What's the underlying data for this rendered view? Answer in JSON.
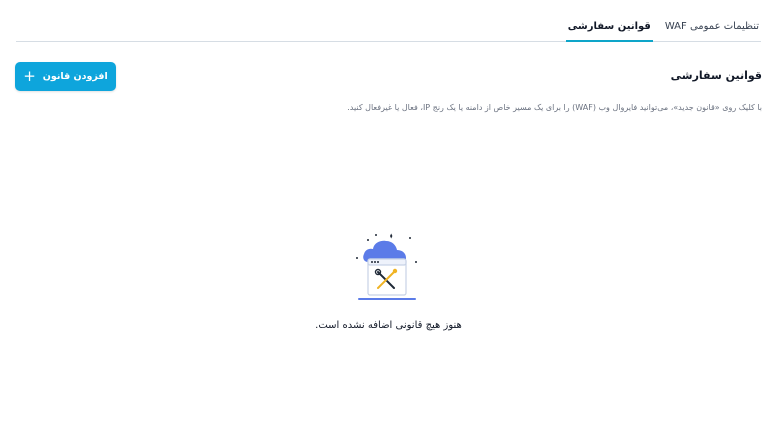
{
  "tabs": [
    {
      "label": "تنظیمات عمومی WAF",
      "active": false
    },
    {
      "label": "قوانین سفارشی",
      "active": true
    }
  ],
  "section": {
    "title": "قوانین سفارشی",
    "add_button_label": "افزودن قانون",
    "description": "با کلیک روی «قانون جدید»، می‌توانید فایروال وب (WAF) را برای یک مسیر خاص از دامنه یا یک رنج IP، فعال یا غیرفعال کنید."
  },
  "empty_state": {
    "message": "هنوز هیچ قانونی اضافه نشده است."
  },
  "colors": {
    "accent": "#0ea5dc",
    "tab_underline": "#0ea5c9",
    "illustration_blue": "#5b7be8"
  }
}
